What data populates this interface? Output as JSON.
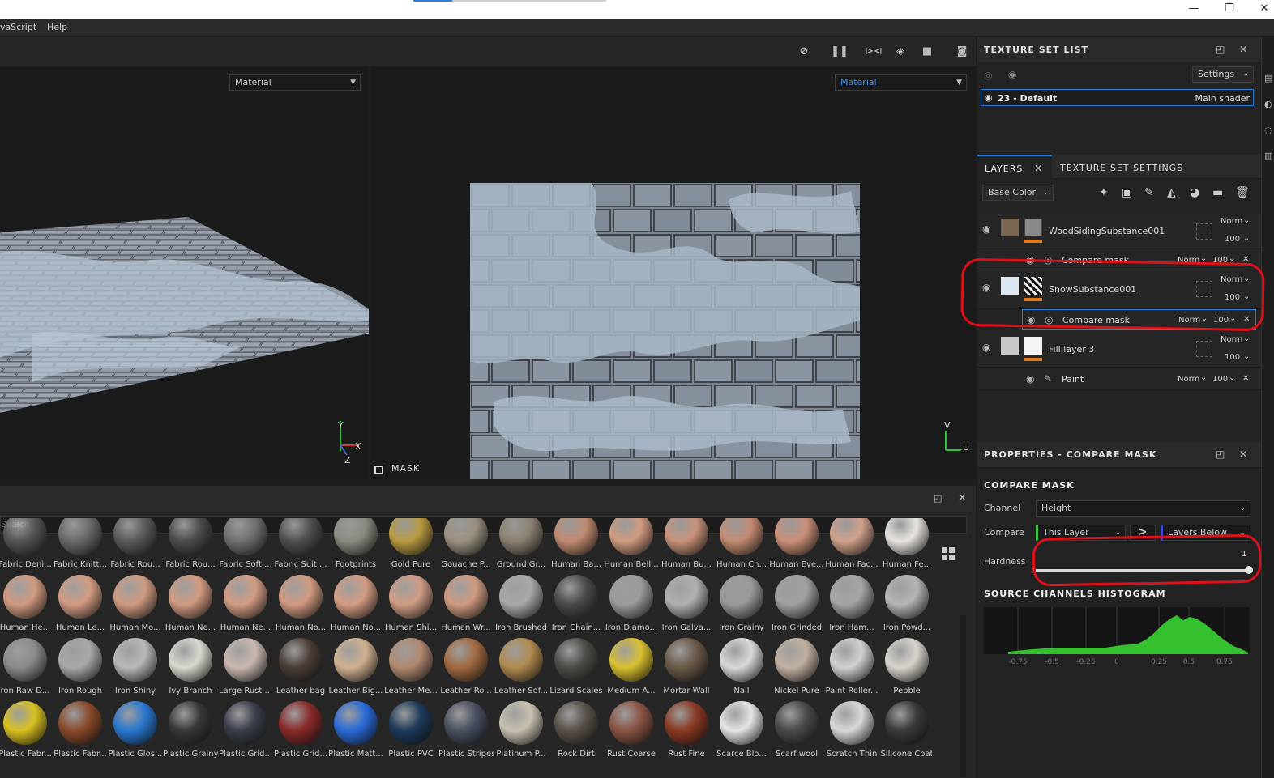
{
  "window": {
    "minimize": "—",
    "restore": "❐",
    "close": "✕"
  },
  "menu": {
    "item1": "vaScript",
    "item2": "Help"
  },
  "toolbar": {
    "icons": [
      "hide-icon",
      "pause-icon",
      "symmetry-icon",
      "cube-icon",
      "camera-icon",
      "screenshot-icon"
    ]
  },
  "viewport3d": {
    "mode": "Material",
    "axis_y": "Y",
    "axis_x": "X",
    "axis_z": "Z"
  },
  "viewport2d": {
    "mode": "Material",
    "mask_label": "MASK",
    "axis_v": "V",
    "axis_u": "U"
  },
  "shelf": {
    "search_placeholder": "Search...",
    "row1": [
      "Fabric Deni...",
      "Fabric Knitt...",
      "Fabric Rou...",
      "Fabric Rou...",
      "Fabric Soft ...",
      "Fabric Suit ...",
      "Footprints",
      "Gold Pure",
      "Gouache P...",
      "Ground Gr...",
      "Human Ba...",
      "Human Bell...",
      "Human Bu...",
      "Human Ch...",
      "Human Eye...",
      "Human Fac...",
      "Human Fe..."
    ],
    "row2": [
      "Human He...",
      "Human Le...",
      "Human Mo...",
      "Human Ne...",
      "Human Ne...",
      "Human No...",
      "Human No...",
      "Human Shi...",
      "Human Wr...",
      "Iron Brushed",
      "Iron Chain...",
      "Iron Diamo...",
      "Iron Galva...",
      "Iron Grainy",
      "Iron Grinded",
      "Iron Ham...",
      "Iron Powd..."
    ],
    "row3": [
      "ron Raw D...",
      "Iron Rough",
      "Iron Shiny",
      "Ivy Branch",
      "Large Rust ...",
      "Leather bag",
      "Leather Big...",
      "Leather Me...",
      "Leather Ro...",
      "Leather Sof...",
      "Lizard Scales",
      "Medium A...",
      "Mortar Wall",
      "Nail",
      "Nickel Pure",
      "Paint Roller...",
      "Pebble"
    ],
    "row4": [
      "Plastic Fabr...",
      "Plastic Fabr...",
      "Plastic Glos...",
      "Plastic Grainy",
      "Plastic Grid...",
      "Plastic Grid...",
      "Plastic Matt...",
      "Plastic PVC",
      "Plastic Stripes",
      "Platinum P...",
      "Rock Dirt",
      "Rust Coarse",
      "Rust Fine",
      "Scarce Blo...",
      "Scarf wool",
      "Scratch Thin",
      "Silicone Coat"
    ]
  },
  "texture_set_list": {
    "title": "TEXTURE SET LIST",
    "settings_label": "Settings",
    "set_name": "23 - Default",
    "shader": "Main shader"
  },
  "layers_panel": {
    "tab_layers": "LAYERS",
    "tab_tss": "TEXTURE SET SETTINGS",
    "channel": "Base Color",
    "layers": [
      {
        "name": "WoodSidingSubstance001",
        "blend": "Norm",
        "opacity": "100"
      },
      {
        "name": "SnowSubstance001",
        "blend": "Norm",
        "opacity": "100"
      },
      {
        "name": "Fill layer 3",
        "blend": "Norm",
        "opacity": "100"
      }
    ],
    "effects": [
      {
        "name": "Compare mask",
        "blend": "Norm",
        "opacity": "100"
      },
      {
        "name": "Compare mask",
        "blend": "Norm",
        "opacity": "100"
      },
      {
        "name": "Paint",
        "blend": "Norm",
        "opacity": "100"
      }
    ]
  },
  "properties": {
    "title": "PROPERTIES - COMPARE MASK",
    "section": "COMPARE MASK",
    "channel_label": "Channel",
    "channel_value": "Height",
    "compare_label": "Compare",
    "compare_a": "This Layer",
    "compare_op": ">",
    "compare_b": "Layers Below",
    "hardness_label": "Hardness",
    "hardness_value": "1",
    "hardness_level": 1.0,
    "histogram_title": "SOURCE CHANNELS HISTOGRAM",
    "histogram_ticks": [
      "-0.75",
      "-0.5",
      "-0.25",
      "0",
      "0.25",
      "0.5",
      "0.75"
    ]
  },
  "colors": {
    "accent": "#2f7bd8",
    "orange": "#e07a1c",
    "annotation": "#e0101a",
    "histogram": "#35c12f"
  }
}
